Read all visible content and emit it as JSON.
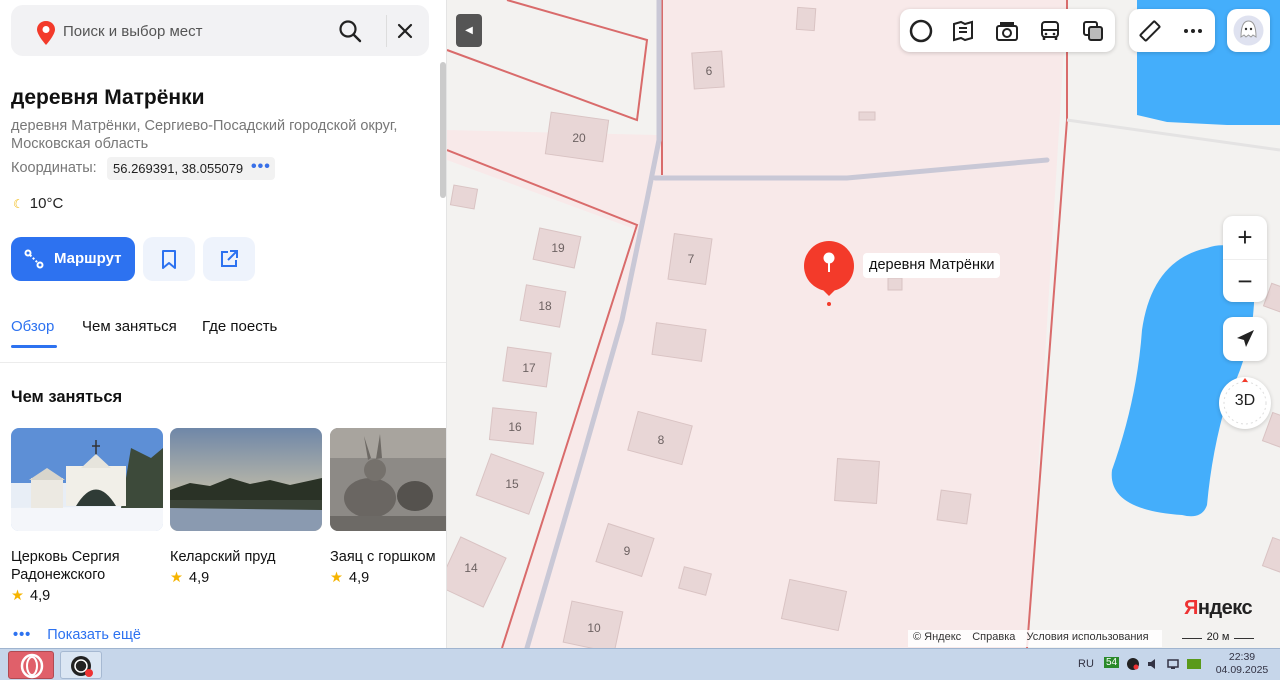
{
  "search": {
    "placeholder": "Поиск и выбор мест"
  },
  "place": {
    "title": "деревня Матрёнки",
    "address": "деревня Матрёнки, Сергиево-Посадский городской округ, Московская область",
    "coords_label": "Координаты:",
    "coords_value": "56.269391, 38.055079",
    "temperature": "10°C"
  },
  "actions": {
    "route_label": "Маршрут"
  },
  "tabs": [
    {
      "label": "Обзор",
      "active": true
    },
    {
      "label": "Чем заняться"
    },
    {
      "label": "Где поесть"
    }
  ],
  "section": {
    "title": "Чем заняться",
    "cards": [
      {
        "name": "Церковь Сергия Радонежского",
        "rating": "4,9"
      },
      {
        "name": "Келарский пруд",
        "rating": "4,9"
      },
      {
        "name": "Заяц с горшком",
        "rating": "4,9"
      }
    ],
    "show_more": "Показать ещё"
  },
  "map": {
    "pin_label": "деревня Матрёнки",
    "logo": "Яндекс",
    "attribution": [
      "© Яндекс",
      "Справка",
      "Условия использования"
    ],
    "scale": "20 м",
    "zoom_in": "+",
    "zoom_out": "−",
    "btn_3d": "3D",
    "house_numbers": [
      "6",
      "20",
      "19",
      "7",
      "18",
      "17",
      "16",
      "8",
      "15",
      "9",
      "14",
      "10"
    ]
  },
  "taskbar": {
    "lang": "RU",
    "badge": "54",
    "time": "22:39",
    "date": "04.09.2025"
  },
  "colors": {
    "accent": "#2d72f0",
    "pin": "#f33a2a",
    "water": "#44aefb",
    "parcel": "#d96b6b"
  }
}
